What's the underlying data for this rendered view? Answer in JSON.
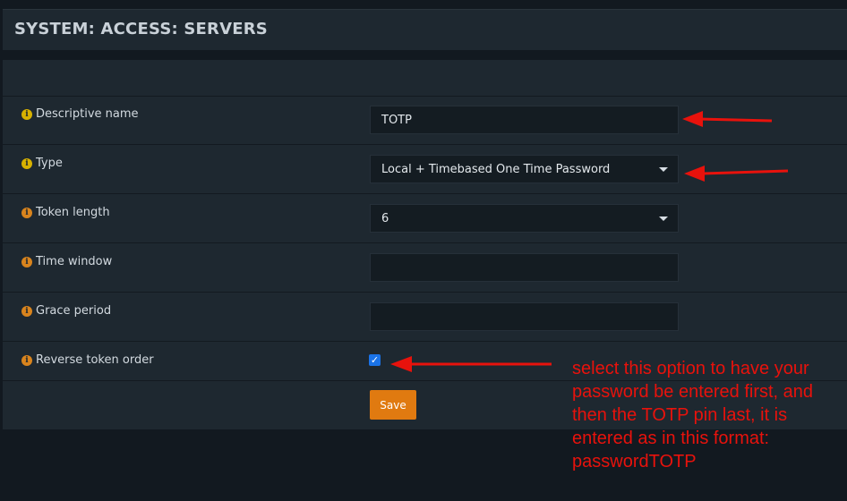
{
  "header": {
    "title": "SYSTEM: ACCESS: SERVERS"
  },
  "form": {
    "fields": [
      {
        "label": "Descriptive name",
        "value": "TOTP",
        "icon": "info-icon",
        "icon_color": "#d7b100"
      },
      {
        "label": "Type",
        "value": "Local + Timebased One Time Password",
        "icon": "info-icon",
        "icon_color": "#d7b100"
      },
      {
        "label": "Token length",
        "value": "6",
        "icon": "info-icon",
        "icon_color": "#d9841d"
      },
      {
        "label": "Time window",
        "value": "",
        "icon": "info-icon",
        "icon_color": "#d9841d"
      },
      {
        "label": "Grace period",
        "value": "",
        "icon": "info-icon",
        "icon_color": "#d9841d"
      },
      {
        "label": "Reverse token order",
        "checked": true,
        "icon": "info-icon",
        "icon_color": "#d9841d"
      }
    ],
    "save_label": "Save"
  },
  "annotation": {
    "lines": [
      "select this option to have your",
      "password be entered first, and",
      "then the TOTP pin last, it is",
      "entered as in this format:",
      "passwordTOTP"
    ],
    "color": "#e8120c"
  },
  "colors": {
    "background": "#121920",
    "panel": "#1e2830",
    "accent_save": "#e07a10",
    "checkbox": "#1a73e8"
  }
}
